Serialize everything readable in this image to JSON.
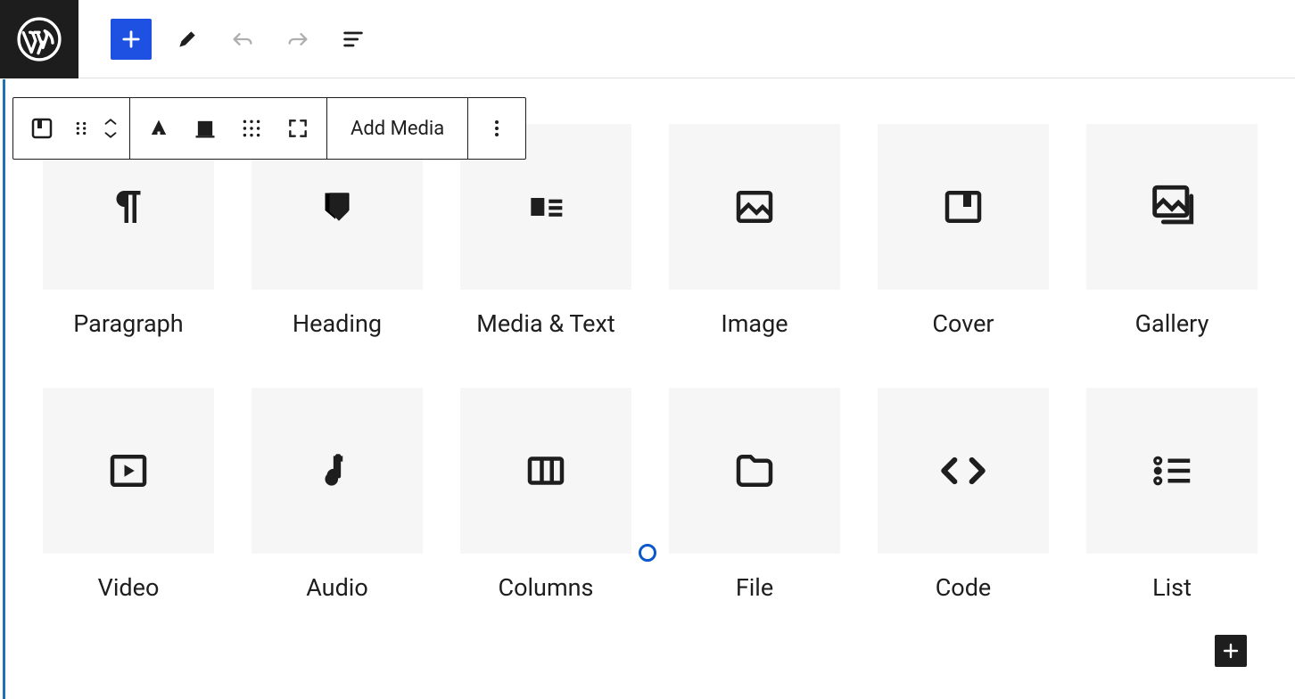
{
  "toolbar": {
    "add_media_label": "Add Media"
  },
  "blocks": [
    {
      "id": "paragraph",
      "label": "Paragraph"
    },
    {
      "id": "heading",
      "label": "Heading"
    },
    {
      "id": "media-text",
      "label": "Media & Text"
    },
    {
      "id": "image",
      "label": "Image"
    },
    {
      "id": "cover",
      "label": "Cover"
    },
    {
      "id": "gallery",
      "label": "Gallery"
    },
    {
      "id": "video",
      "label": "Video"
    },
    {
      "id": "audio",
      "label": "Audio"
    },
    {
      "id": "columns",
      "label": "Columns"
    },
    {
      "id": "file",
      "label": "File"
    },
    {
      "id": "code",
      "label": "Code"
    },
    {
      "id": "list",
      "label": "List"
    }
  ]
}
